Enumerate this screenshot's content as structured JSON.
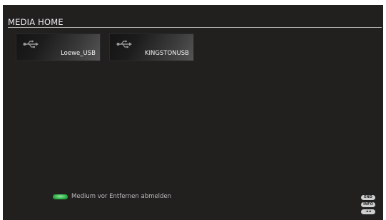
{
  "header": {
    "title": "MEDIA HOME"
  },
  "devices": [
    {
      "label": "Loewe_USB",
      "icon": "usb-icon"
    },
    {
      "label": "KINGSTONUSB",
      "icon": "usb-icon"
    }
  ],
  "hint": {
    "button_color": "#2fae47",
    "text": "Medium vor Entfernen abmelden"
  },
  "keys": {
    "end": "END",
    "info": "INFO",
    "back": "◄◄"
  }
}
